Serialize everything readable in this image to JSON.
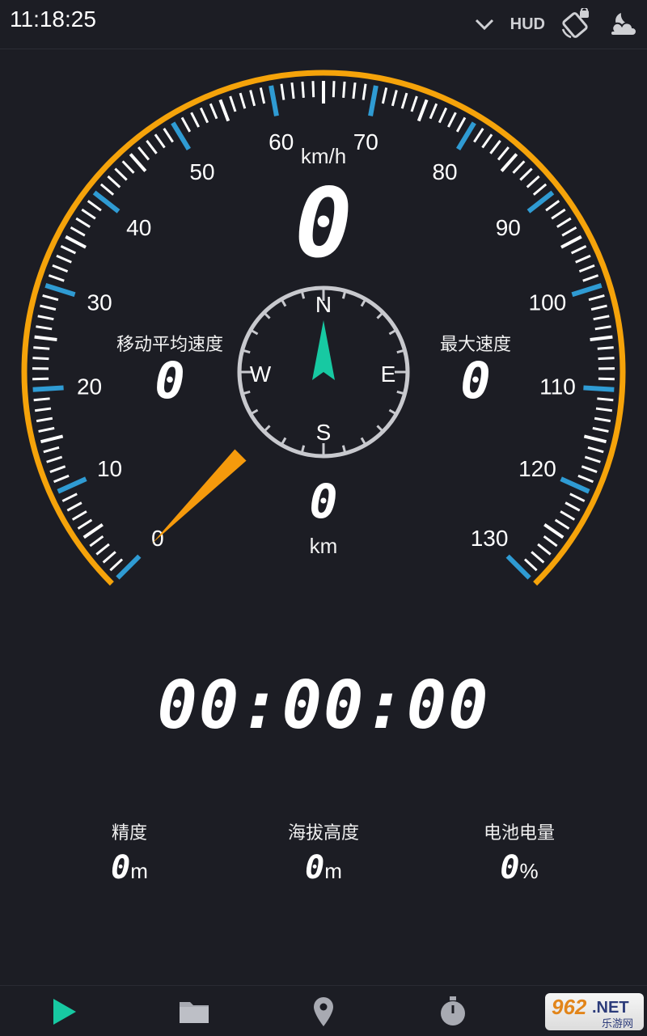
{
  "status_bar": {
    "time": "11:18:25",
    "hud_label": "HUD"
  },
  "gauge": {
    "unit": "km/h",
    "speed": "0",
    "tick_labels": [
      "0",
      "10",
      "20",
      "30",
      "40",
      "50",
      "60",
      "70",
      "80",
      "90",
      "100",
      "110",
      "120",
      "130"
    ],
    "avg_speed_label": "移动平均速度",
    "avg_speed_value": "0",
    "max_speed_label": "最大速度",
    "max_speed_value": "0",
    "distance_value": "0",
    "distance_unit": "km",
    "needle_value": 0,
    "colors": {
      "arc": "#f5a30a",
      "major_tick": "#2f9bd3",
      "needle": "#f59a0c",
      "compass_needle": "#17c9a2"
    }
  },
  "compass": {
    "n": "N",
    "s": "S",
    "e": "E",
    "w": "W"
  },
  "timer": {
    "value": "00:00:00"
  },
  "stats": {
    "accuracy_label": "精度",
    "accuracy_value": "0",
    "accuracy_unit": "m",
    "altitude_label": "海拔高度",
    "altitude_value": "0",
    "altitude_unit": "m",
    "battery_label": "电池电量",
    "battery_value": "0",
    "battery_unit": "%"
  },
  "watermark": {
    "brand_num": "962",
    "brand_net": ".NET",
    "brand_cn": "乐游网"
  },
  "nav": {
    "icons": [
      "play-icon",
      "folder-icon",
      "location-pin-icon",
      "stopwatch-icon"
    ]
  }
}
